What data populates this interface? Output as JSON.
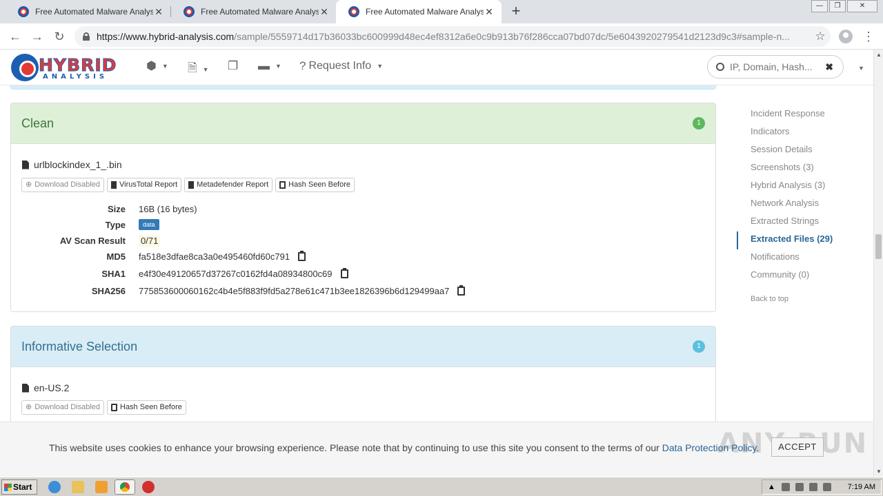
{
  "browser": {
    "tabs": [
      {
        "title": "Free Automated Malware Analysis S",
        "close": "✕"
      },
      {
        "title": "Free Automated Malware Analysis S",
        "close": "✕"
      },
      {
        "title": "Free Automated Malware Analysis S",
        "close": "✕"
      }
    ],
    "new_tab": "+",
    "window_buttons": {
      "minimize": "—",
      "maximize": "❐",
      "close": "✕"
    },
    "url_host": "https://www.hybrid-analysis.com",
    "url_path": "/sample/5559714d17b36033bc600999d48ec4ef8312a6e0c9b913b76f286cca07bd07dc/5e6043920279541d2123d9c3#sample-n..."
  },
  "site": {
    "logo_word": "HYBRID",
    "logo_sub": "ANALYSIS",
    "menu_request_info": "Request Info",
    "search_placeholder": "IP, Domain, Hash...",
    "search_clear": "✖"
  },
  "clean_panel": {
    "title": "Clean",
    "count": "1",
    "filename": "urlblockindex_1_.bin",
    "buttons": {
      "download": "Download Disabled",
      "virustotal": "VirusTotal Report",
      "metadefender": "Metadefender Report",
      "hash_seen": "Hash Seen Before"
    },
    "fields": {
      "size_label": "Size",
      "size": "16B (16 bytes)",
      "type_label": "Type",
      "type": "data",
      "av_label": "AV Scan Result",
      "av": "0/71",
      "md5_label": "MD5",
      "md5": "fa518e3dfae8ca3a0e495460fd60c791",
      "sha1_label": "SHA1",
      "sha1": "e4f30e49120657d37267c0162fd4a08934800c69",
      "sha256_label": "SHA256",
      "sha256": "775853600060162c4b4e5f883f9fd5a278e61c471b3ee1826396b6d129499aa7"
    }
  },
  "info_panel": {
    "title": "Informative Selection",
    "count": "1",
    "filename": "en-US.2",
    "buttons": {
      "download": "Download Disabled",
      "hash_seen": "Hash Seen Before"
    }
  },
  "sidenav": {
    "items": [
      {
        "label": "Incident Response"
      },
      {
        "label": "Indicators"
      },
      {
        "label": "Session Details"
      },
      {
        "label": "Screenshots (3)"
      },
      {
        "label": "Hybrid Analysis (3)"
      },
      {
        "label": "Network Analysis"
      },
      {
        "label": "Extracted Strings"
      },
      {
        "label": "Extracted Files (29)"
      },
      {
        "label": "Notifications"
      },
      {
        "label": "Community (0)"
      }
    ],
    "back_to_top": "Back to top"
  },
  "cookie": {
    "message": "This website uses cookies to enhance your browsing experience. Please note that by continuing to use this site you consent to the terms of our ",
    "link": "Data Protection Policy",
    "period": ".",
    "accept": "ACCEPT",
    "watermark": "ANY RUN"
  },
  "taskbar": {
    "start": "Start",
    "clock": "7:19 AM"
  },
  "colors": {
    "clean_bg": "#dff0d8",
    "info_bg": "#d9edf7",
    "link": "#2a6496",
    "brand_red": "#e53935",
    "brand_blue": "#1c5fb0"
  }
}
